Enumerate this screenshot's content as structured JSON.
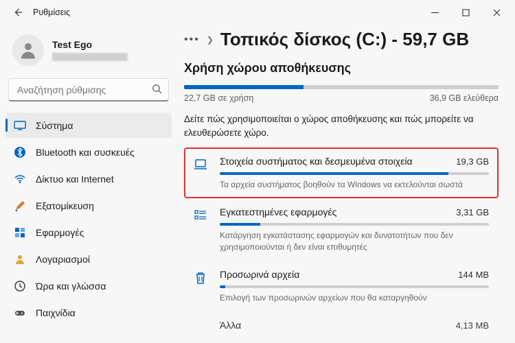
{
  "titlebar": {
    "title": "Ρυθμίσεις"
  },
  "profile": {
    "name": "Test Ego"
  },
  "search": {
    "placeholder": "Αναζήτηση ρύθμισης"
  },
  "sidebar": {
    "items": [
      {
        "label": "Σύστημα"
      },
      {
        "label": "Bluetooth και συσκευές"
      },
      {
        "label": "Δίκτυο και Internet"
      },
      {
        "label": "Εξατομίκευση"
      },
      {
        "label": "Εφαρμογές"
      },
      {
        "label": "Λογαριασμοί"
      },
      {
        "label": "Ώρα και γλώσσα"
      },
      {
        "label": "Παιχνίδια"
      }
    ]
  },
  "breadcrumb": {
    "title": "Τοπικός δίσκος (C:) - 59,7 GB"
  },
  "storage": {
    "section_title": "Χρήση χώρου αποθήκευσης",
    "used_label": "22,7 GB σε χρήση",
    "free_label": "36,9 GB ελεύθερα",
    "used_pct": 38,
    "desc": "Δείτε πώς χρησιμοποιείται ο χώρος αποθήκευσης και πώς μπορείτε να ελευθερώσετε χώρο.",
    "categories": [
      {
        "title": "Στοιχεία συστήματος και δεσμευμένα στοιχεία",
        "size": "19,3 GB",
        "pct": 85,
        "sub": "Τα αρχεία συστήματος βοηθούν τα Windows να εκτελούνται σωστά"
      },
      {
        "title": "Εγκατεστημένες εφαρμογές",
        "size": "3,31 GB",
        "pct": 15,
        "sub": "Κατάργηση εγκατάστασης εφαρμογών και δυνατοτήτων που δεν χρησιμοποιούνται ή δεν είναι επιθυμητές"
      },
      {
        "title": "Προσωρινά αρχεία",
        "size": "144 MB",
        "pct": 2,
        "sub": "Επιλογή των προσωρινών αρχείων που θα καταργηθούν"
      },
      {
        "title": "Άλλα",
        "size": "4,13 MB",
        "pct": 1,
        "sub": ""
      }
    ]
  }
}
